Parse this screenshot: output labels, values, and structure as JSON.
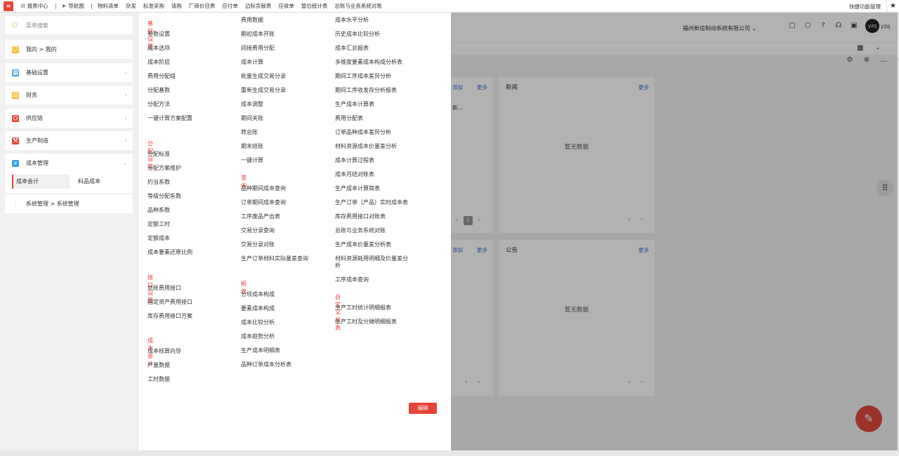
{
  "topbar": {
    "logo": "≡",
    "nav": [
      {
        "label": "报表中心",
        "icon": "bar-chart-icon",
        "glyph": "ıll"
      },
      {
        "label": "导航图",
        "icon": "send-icon",
        "glyph": "➤"
      },
      {
        "label": "物料清单"
      },
      {
        "label": "杂发"
      },
      {
        "label": "标准采购"
      },
      {
        "label": "请购"
      },
      {
        "label": "厂商价目表"
      },
      {
        "label": "应付单"
      },
      {
        "label": "边际贡献表"
      },
      {
        "label": "应收单"
      },
      {
        "label": "暂估统计表"
      },
      {
        "label": "总账与业务系统对账"
      }
    ],
    "quick_label": "快捷功能管理",
    "star": "★"
  },
  "background": {
    "company": "福州新信制动系统有限公司 ⌄",
    "avatar_text": "yzq",
    "avatar_name": "yzq",
    "cards": {
      "left_top_add": "添加",
      "left_top_more": "更多",
      "left_top_snippet": "新...",
      "news_title": "新闻",
      "news_more": "更多",
      "news_empty": "暂无数据",
      "notice_title": "公告",
      "notice_more": "更多",
      "notice_empty": "暂无数据",
      "left_bottom_add": "添加",
      "left_bottom_more": "更多",
      "page_num": "1"
    }
  },
  "drawer": {
    "search_placeholder": "菜单搜索",
    "left_menu": [
      {
        "label": "我的 > 我的",
        "icon": "star-badge-icon",
        "color": "#f5b81c",
        "glyph": "☺"
      },
      {
        "label": "基础设置",
        "icon": "grid-icon",
        "color": "#3aa0e8",
        "glyph": "▦"
      },
      {
        "label": "财务",
        "icon": "document-icon",
        "color": "#f5b81c",
        "glyph": "▤"
      },
      {
        "label": "供应链",
        "icon": "supply-chain-icon",
        "color": "#e8433a",
        "glyph": "⛭"
      },
      {
        "label": "生产制造",
        "icon": "factory-icon",
        "color": "#e8433a",
        "glyph": "⚒"
      }
    ],
    "cost_mgmt": {
      "label": "成本管理",
      "sub_active": "成本会计",
      "sub_other": "料品成本"
    },
    "sys_mgmt": "系统管理 > 系统管理",
    "col1": {
      "groups": [
        {
          "title": "基础设置",
          "items": [
            "参数设置",
            "成本选项",
            "成本阶层",
            "费用分配组",
            "分配基数",
            "分配方法",
            "一键计算方案配置"
          ]
        },
        {
          "title": "分配设定",
          "items": [
            "分配标准",
            "分配方案维护",
            "约当系数",
            "等级分配系数",
            "品种系数",
            "定额工时",
            "定额成本",
            "成本要素还原比例"
          ]
        },
        {
          "title": "接口设置",
          "items": [
            "总账费用接口",
            "固定资产费用接口",
            "库存费用接口方案"
          ]
        },
        {
          "title": "成本会计",
          "items": [
            "成本核算向导",
            "产量数据",
            "工时数据"
          ]
        }
      ]
    },
    "col2": {
      "pre_items": [
        "费用数据",
        "期初成本开账",
        "间接费用分配",
        "成本计算",
        "批量生成交易分录",
        "重新生成交易分录",
        "成本调整",
        "期间关账",
        "转总账",
        "期末结账",
        "一键计算"
      ],
      "groups": [
        {
          "title": "查询",
          "items": [
            "品种期间成本查询",
            "订单期间成本查询",
            "工序废品产出表",
            "交易分录查询",
            "交易分录对账",
            "生产订单材料实际量差查询"
          ]
        },
        {
          "title": "报表",
          "items": [
            "分项成本构成",
            "要素成本构成",
            "成本比较分析",
            "成本趋势分析",
            "生产成本明细表",
            "品种订单成本分析表"
          ]
        }
      ]
    },
    "col3": {
      "pre_items": [
        "成本水平分析",
        "历史成本比较分析",
        "成本汇总报表",
        "多维度要素成本构成分析表",
        "期间工序成本差异分析",
        "期间工序收发存分析报表",
        "生产成本计算表",
        "费用分配表",
        "订单品种成本差异分析",
        "材料资源成本价量差分析",
        "成本计算过程表",
        "成本月结对账表",
        "生产成本计算简表",
        "生产订单（产品）实时成本表",
        "库存费用接口对账表",
        "总账与业务系统对账",
        "生产成本价量差分析表",
        "材料资源耗用明细及价量差分",
        "析",
        "工序成本查询"
      ],
      "groups": [
        {
          "title": "自定义报表",
          "items": [
            "生产工时统计明细报表",
            "生产工时及分摊明细报表"
          ]
        }
      ]
    },
    "edit_button": "编辑"
  }
}
